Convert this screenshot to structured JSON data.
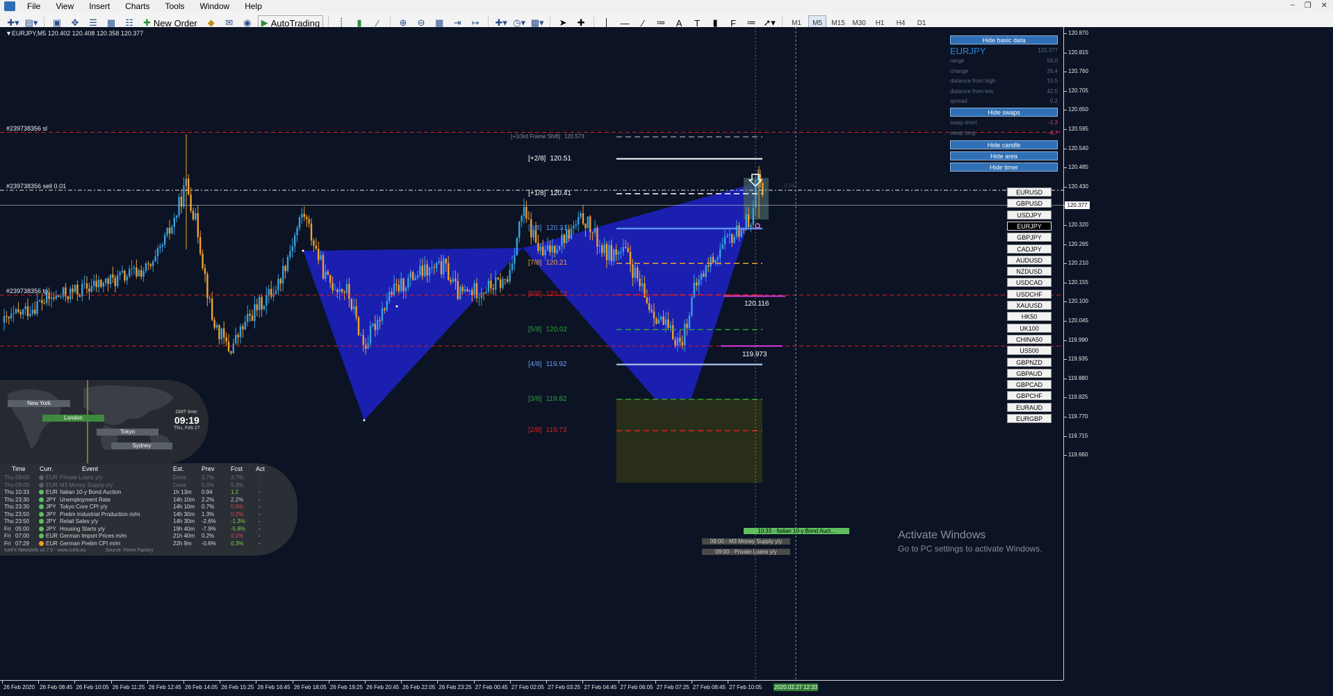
{
  "menu": [
    "File",
    "View",
    "Insert",
    "Charts",
    "Tools",
    "Window",
    "Help"
  ],
  "toolbar": {
    "new_order": "New Order",
    "autotrading": "AutoTrading",
    "periods": [
      "M1",
      "M5",
      "M15",
      "M30",
      "H1",
      "H4",
      "D1"
    ],
    "active_period": "M5"
  },
  "chart": {
    "symbol_line": "EURJPY,M5  120.402 120.408 120.358 120.377",
    "current_price": "120.377",
    "current_time": "2020.02.27 12:33",
    "orders": [
      {
        "label": "#239738356 sl",
        "price": 120.586
      },
      {
        "label": "#239738356 sell 0.01",
        "price": 120.42
      },
      {
        "label": "#239738356 tp",
        "price": 120.119
      }
    ],
    "murrey": [
      {
        "label": "[+1/3rd Frame Shift]",
        "value": "120.573",
        "price": 120.573,
        "color": "#8a8f99"
      },
      {
        "label": "[+2/8]",
        "value": "120.51",
        "price": 120.51,
        "color": "#ffffff"
      },
      {
        "label": "[+1/8]",
        "value": "120.41",
        "price": 120.41,
        "color": "#ffffff"
      },
      {
        "label": "[8/8]",
        "value": "120.31",
        "price": 120.31,
        "color": "#5c8ff0"
      },
      {
        "label": "[7/8]",
        "value": "120.21",
        "price": 120.21,
        "color": "#f0a030"
      },
      {
        "label": "[6/8]",
        "value": "120.12",
        "price": 120.12,
        "color": "#e02020"
      },
      {
        "label": "[5/8]",
        "value": "120.02",
        "price": 120.02,
        "color": "#2ea03a"
      },
      {
        "label": "[4/8]",
        "value": "119.92",
        "price": 119.92,
        "color": "#6a9df0"
      },
      {
        "label": "[3/8]",
        "value": "119.82",
        "price": 119.82,
        "color": "#2ea03a"
      },
      {
        "label": "[2/8]",
        "value": "119.73",
        "price": 119.73,
        "color": "#e02020"
      }
    ],
    "level_labels": [
      {
        "text": "120.116",
        "price": 120.116
      },
      {
        "text": "119.973",
        "price": 119.973
      },
      {
        "text": "0.04",
        "price": 120.42
      }
    ],
    "price_axis": [
      "120.870",
      "120.815",
      "120.760",
      "120.705",
      "120.650",
      "120.595",
      "120.540",
      "120.485",
      "120.430",
      "120.375",
      "120.320",
      "120.265",
      "120.210",
      "120.155",
      "120.100",
      "120.045",
      "119.990",
      "119.935",
      "119.880",
      "119.825",
      "119.770",
      "119.715",
      "119.660"
    ],
    "time_axis": [
      "26 Feb 2020",
      "26 Feb 08:45",
      "26 Feb 10:05",
      "26 Feb 11:25",
      "26 Feb 12:45",
      "26 Feb 14:05",
      "26 Feb 15:25",
      "26 Feb 16:45",
      "26 Feb 18:05",
      "26 Feb 19:25",
      "26 Feb 20:45",
      "26 Feb 22:05",
      "26 Feb 23:25",
      "27 Feb 00:45",
      "27 Feb 02:05",
      "27 Feb 03:25",
      "27 Feb 04:45",
      "27 Feb 06:05",
      "27 Feb 07:25",
      "27 Feb 08:45",
      "27 Feb 10:05"
    ]
  },
  "basic_data": {
    "hide_basic_label": "Hide basic data",
    "symbol": "EURJPY",
    "symbol_value": "120.377",
    "rows": [
      {
        "label": "range",
        "value": "58.0"
      },
      {
        "label": "change",
        "value": "26.4"
      },
      {
        "label": "distance from high",
        "value": "15.5"
      },
      {
        "label": "distance from low",
        "value": "42.5"
      },
      {
        "label": "spread",
        "value": "0.2"
      }
    ],
    "hide_swaps_label": "Hide swaps",
    "swaps": [
      {
        "label": "swap short",
        "value": "-1.3"
      },
      {
        "label": "swap long",
        "value": "-3.7"
      }
    ],
    "hide_candle_label": "Hide candle",
    "hide_area_label": "Hide area",
    "hide_timer_label": "Hide timer"
  },
  "pairs": [
    "EURUSD",
    "GBPUSD",
    "USDJPY",
    "EURJPY",
    "GBPJPY",
    "CADJPY",
    "AUDUSD",
    "NZDUSD",
    "USDCAD",
    "USDCHF",
    "XAUUSD",
    "HK50",
    "UK100",
    "CHINA50",
    "US500",
    "GBPNZD",
    "GBPAUD",
    "GBPCAD",
    "GBPCHF",
    "EURAUD",
    "EURGBP"
  ],
  "active_pair": "EURJPY",
  "sessions": {
    "cities": [
      "New York",
      "London",
      "Tokyo",
      "Sydney"
    ],
    "gmt_label": "GMT time:",
    "gmt_time": "09:19",
    "gmt_date": "Thu, Feb 27"
  },
  "news": {
    "headers": [
      "Time",
      "Curr.",
      "Event",
      "Est.",
      "Prev",
      "Fcst",
      "Act"
    ],
    "rows": [
      {
        "day": "Thu",
        "time": "09:00",
        "cur": "EUR",
        "event": "Private Loans y/y",
        "est": "Done",
        "prev": "3.7%",
        "fcst": "3.7%",
        "act": "-",
        "state": "done"
      },
      {
        "day": "Thu",
        "time": "09:00",
        "cur": "EUR",
        "event": "M3 Money Supply y/y",
        "est": "Done",
        "prev": "5.0%",
        "fcst": "5.3%",
        "act": "-",
        "state": "done"
      },
      {
        "day": "Thu",
        "time": "10:33",
        "cur": "EUR",
        "event": "Italian 10-y Bond Auction",
        "est": "1h 13m",
        "prev": "0.94",
        "fcst": "1.2",
        "act": "-",
        "state": "up"
      },
      {
        "day": "Thu",
        "time": "23:30",
        "cur": "JPY",
        "event": "Unemployment Rate",
        "est": "14h 10m",
        "prev": "2.2%",
        "fcst": "2.2%",
        "act": "-",
        "state": "flat"
      },
      {
        "day": "Thu",
        "time": "23:30",
        "cur": "JPY",
        "event": "Tokyo Core CPI y/y",
        "est": "14h 10m",
        "prev": "0.7%",
        "fcst": "0.6%",
        "act": "-",
        "state": "down"
      },
      {
        "day": "Thu",
        "time": "23:50",
        "cur": "JPY",
        "event": "Prelim Industrial Production m/m",
        "est": "14h 30m",
        "prev": "1.3%",
        "fcst": "0.2%",
        "act": "-",
        "state": "down"
      },
      {
        "day": "Thu",
        "time": "23:50",
        "cur": "JPY",
        "event": "Retail Sales y/y",
        "est": "14h 30m",
        "prev": "-2.6%",
        "fcst": "-1.3%",
        "act": "-",
        "state": "up"
      },
      {
        "day": "Fri",
        "time": "05:00",
        "cur": "JPY",
        "event": "Housing Starts y/y",
        "est": "19h 40m",
        "prev": "-7.9%",
        "fcst": "-5.8%",
        "act": "-",
        "state": "up"
      },
      {
        "day": "Fri",
        "time": "07:00",
        "cur": "EUR",
        "event": "German Import Prices m/m",
        "est": "21h 40m",
        "prev": "0.2%",
        "fcst": "0.1%",
        "act": "-",
        "state": "down"
      },
      {
        "day": "Fri",
        "time": "07:29",
        "cur": "EUR",
        "event": "German Prelim CPI m/m",
        "est": "22h 9m",
        "prev": "-0.6%",
        "fcst": "0.3%",
        "act": "-",
        "state": "up"
      }
    ],
    "footer_left": "IceFX NewsInfo v2.7.0  -  www.icefx.eu",
    "footer_right": "Source: Forex Factory"
  },
  "event_bars": [
    {
      "text": "10:33 - Italian 10-y Bond Auct...",
      "color": "#5fbf5f",
      "fg": "#000000"
    },
    {
      "text": "09:00 - M3 Money Supply y/y",
      "color": "#4a4a4a",
      "fg": "#cfcfcf"
    },
    {
      "text": "09:00 - Private Loans y/y",
      "color": "#4a4a4a",
      "fg": "#cfcfcf"
    }
  ],
  "watermark": {
    "title": "Activate Windows",
    "subtitle": "Go to PC settings to activate Windows."
  },
  "colors": {
    "background": "#0b1324",
    "bull": "#3aa0e0",
    "bear": "#f0a030",
    "pattern": "#1d22c8",
    "button": "#2f6fb5"
  }
}
